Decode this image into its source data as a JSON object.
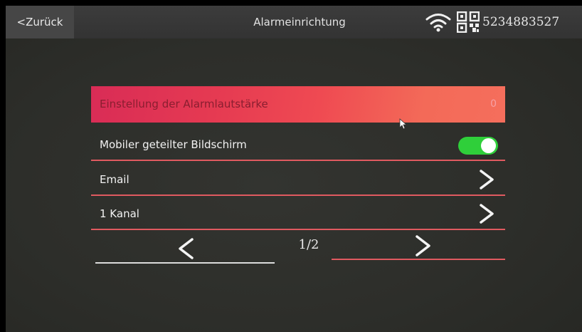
{
  "header": {
    "back_label": "<Zurück",
    "title": "Alarmeinrichtung",
    "device_id": "5234883527",
    "icons": [
      "wifi-icon",
      "qr-code-icon"
    ]
  },
  "settings": {
    "items": [
      {
        "label": "Einstellung der Alarmlautstärke",
        "value": "0",
        "highlighted": true
      },
      {
        "label": "Mobiler geteilter Bildschirm",
        "control": "toggle",
        "toggle_on": true
      },
      {
        "label": "Email",
        "control": "chevron-right-icon"
      },
      {
        "label": "1 Kanal",
        "control": "chevron-right-icon"
      }
    ]
  },
  "pager": {
    "indicator": "1/2",
    "prev_icon": "chevron-left-icon",
    "next_icon": "chevron-right-icon"
  },
  "colors": {
    "highlight": "#e53a52",
    "separator": "#e05a60",
    "toggle_on": "#2fcf3a",
    "background": "#2d2e2a"
  }
}
